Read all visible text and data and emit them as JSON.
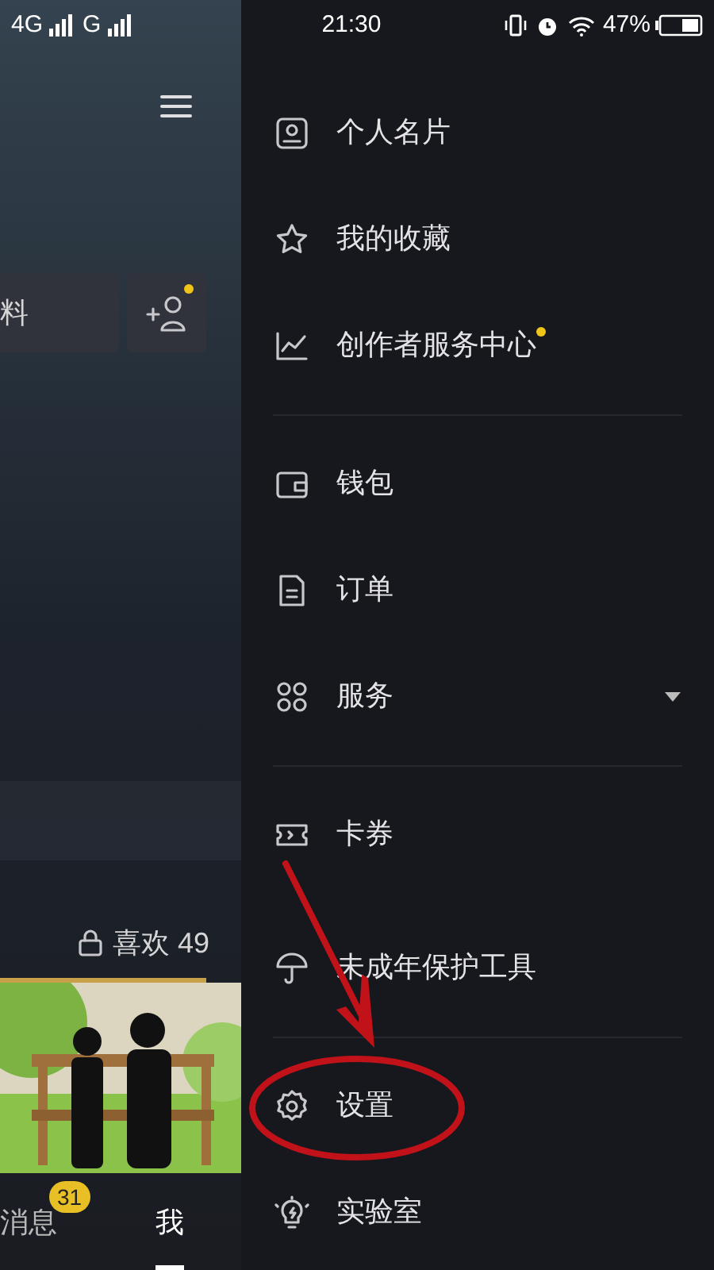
{
  "status_bar": {
    "carrier_1": "4G",
    "carrier_2": "G",
    "time": "21:30",
    "battery": "47%"
  },
  "profile_panel": {
    "partial_button": "料",
    "add_friend_dot": true,
    "likes_tab": "喜欢 49"
  },
  "bottom_nav": [
    {
      "label": "消息",
      "badge": "31",
      "selected": false
    },
    {
      "label": "我",
      "selected": true
    }
  ],
  "drawer": {
    "sections": [
      {
        "items": [
          {
            "label": "个人名片",
            "dot": false
          },
          {
            "label": "我的收藏",
            "dot": false
          },
          {
            "label": "创作者服务中心",
            "dot": true
          }
        ]
      },
      {
        "items": [
          {
            "label": "钱包",
            "dot": false
          },
          {
            "label": "订单",
            "dot": false
          },
          {
            "label": "服务",
            "dot": false,
            "expanded": false
          }
        ]
      },
      {
        "items": [
          {
            "label": "卡券",
            "dot": false
          },
          {
            "label": "未成年保护工具",
            "dot": false
          }
        ]
      },
      {
        "items": [
          {
            "label": "设置",
            "dot": false
          },
          {
            "label": "实验室",
            "dot": false
          }
        ]
      }
    ]
  },
  "annotations": {
    "red_arrow": true,
    "red_ellipse": true
  }
}
